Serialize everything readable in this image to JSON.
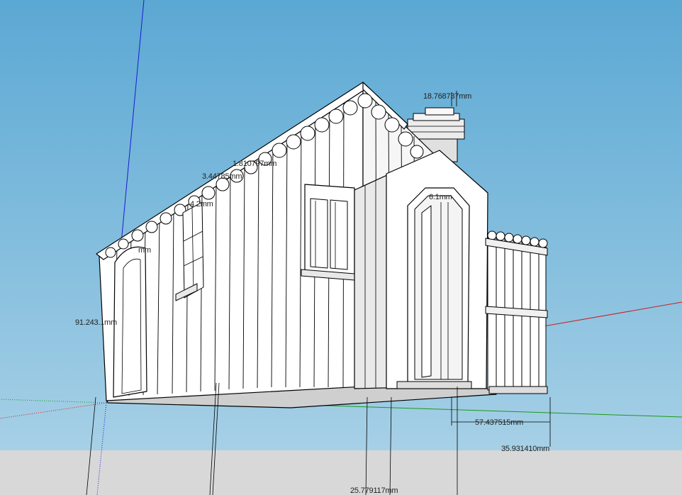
{
  "app": {
    "type": "3d-modeling-viewport",
    "colors": {
      "sky_top": "#5ba8d4",
      "sky_bottom": "#a6d0e6",
      "ground": "#d8d8d8",
      "red_axis": "#c81e1e",
      "green_axis": "#1a9a1a",
      "blue_axis": "#1a1ad0",
      "model_fill": "#ffffff",
      "model_shade": "#d2d2d2",
      "model_stroke": "#000000"
    }
  },
  "dimensions": {
    "chimney_height": "18.768737mm",
    "roof_trim_1": "1.810797mm",
    "roof_trim_2": "3.44785mm",
    "small_label_1": "4.2mm",
    "small_label_2": "6.1mm",
    "side_left": "mm",
    "wall_height": "91.243...mm",
    "fence_length": "57.437515mm",
    "fence_offset": "35.931410mm",
    "base_depth": "25.779117mm"
  }
}
